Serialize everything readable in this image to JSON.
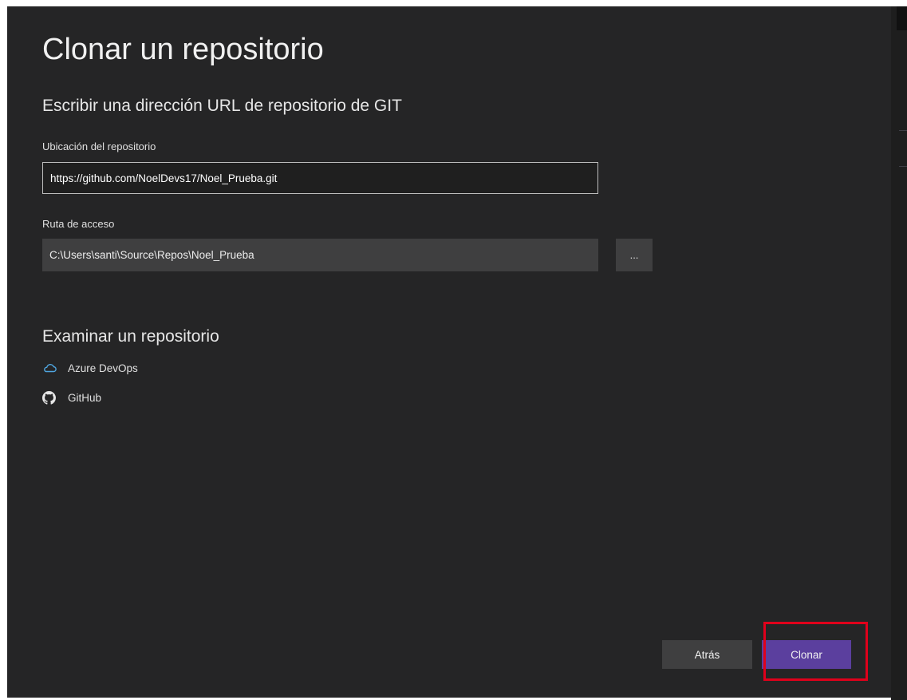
{
  "dialog": {
    "title": "Clonar un repositorio",
    "subtitle": "Escribir una dirección URL de repositorio de GIT"
  },
  "repo_location": {
    "label": "Ubicación del repositorio",
    "value": "https://github.com/NoelDevs17/Noel_Prueba.git"
  },
  "path": {
    "label": "Ruta de acceso",
    "value": "C:\\Users\\santi\\Source\\Repos\\Noel_Prueba",
    "browse_label": "..."
  },
  "browse_section": {
    "title": "Examinar un repositorio",
    "items": [
      {
        "label": "Azure DevOps",
        "icon": "cloud-icon"
      },
      {
        "label": "GitHub",
        "icon": "github-icon"
      }
    ]
  },
  "footer": {
    "back_label": "Atrás",
    "clone_label": "Clonar"
  },
  "colors": {
    "background": "#252526",
    "accent": "#5b3f9e",
    "highlight": "#e0001b"
  }
}
